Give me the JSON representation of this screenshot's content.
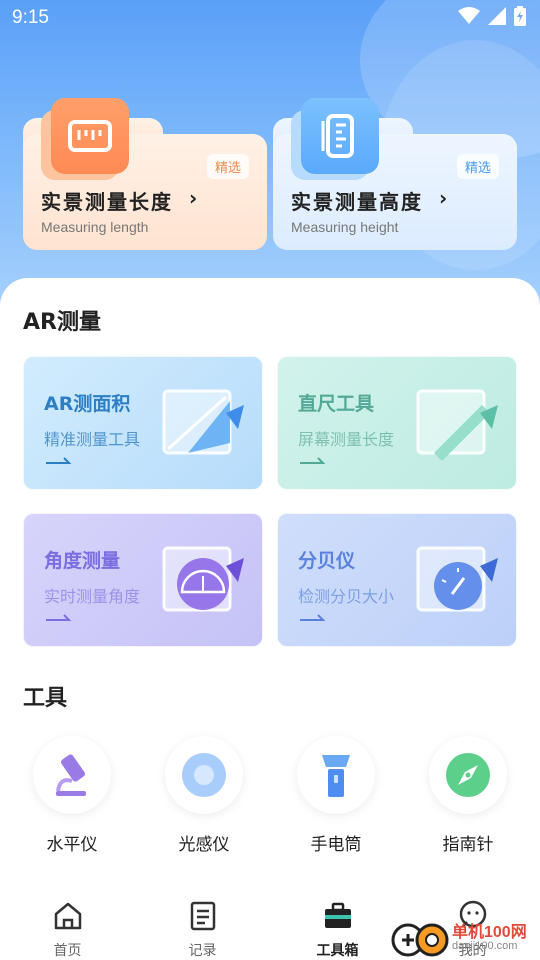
{
  "status_bar": {
    "time": "9:15"
  },
  "top_cards": [
    {
      "title": "实景测量长度",
      "subtitle": "Measuring length",
      "badge": "精选",
      "icon": "ruler-horizontal-icon"
    },
    {
      "title": "实景测量高度",
      "subtitle": "Measuring height",
      "badge": "精选",
      "icon": "ruler-vertical-icon"
    }
  ],
  "ar_section": {
    "title": "AR测量",
    "cards": [
      {
        "title": "AR测面积",
        "subtitle": "精准测量工具",
        "icon": "area-icon"
      },
      {
        "title": "直尺工具",
        "subtitle": "屏幕测量长度",
        "icon": "ruler-icon"
      },
      {
        "title": "角度测量",
        "subtitle": "实时测量角度",
        "icon": "protractor-icon"
      },
      {
        "title": "分贝仪",
        "subtitle": "检测分贝大小",
        "icon": "decibel-gauge-icon"
      }
    ]
  },
  "tools_section": {
    "title": "工具",
    "items": [
      {
        "label": "水平仪",
        "icon": "microscope-icon"
      },
      {
        "label": "光感仪",
        "icon": "light-sensor-icon"
      },
      {
        "label": "手电筒",
        "icon": "flashlight-icon"
      },
      {
        "label": "指南针",
        "icon": "compass-icon"
      }
    ]
  },
  "bottom_nav": {
    "items": [
      {
        "label": "首页",
        "icon": "home-icon"
      },
      {
        "label": "记录",
        "icon": "document-icon"
      },
      {
        "label": "工具箱",
        "icon": "toolbox-icon",
        "active": true
      },
      {
        "label": "我的",
        "icon": "profile-icon"
      }
    ]
  },
  "watermark": {
    "text": "单机100网",
    "url": "danji100.com"
  },
  "colors": {
    "hero_blue": "#5aa0f8",
    "length_orange": "#ff8a55",
    "height_blue": "#5aa9fb"
  }
}
